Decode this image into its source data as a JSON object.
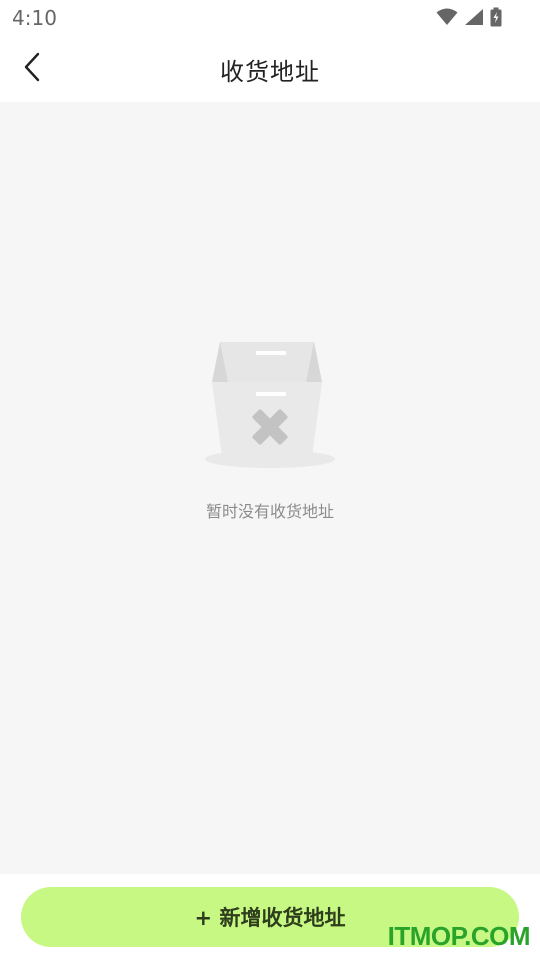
{
  "status_bar": {
    "time": "4:10",
    "icons": [
      "wifi-icon",
      "signal-icon",
      "battery-icon"
    ]
  },
  "header": {
    "back_icon": "chevron-left-icon",
    "title": "收货地址"
  },
  "empty_state": {
    "illustration": "empty-box-icon",
    "message": "暂时没有收货地址"
  },
  "footer": {
    "add_button_label": "+ 新增收货地址",
    "accent_color": "#c6f883"
  },
  "watermark": "ITMOP.COM"
}
